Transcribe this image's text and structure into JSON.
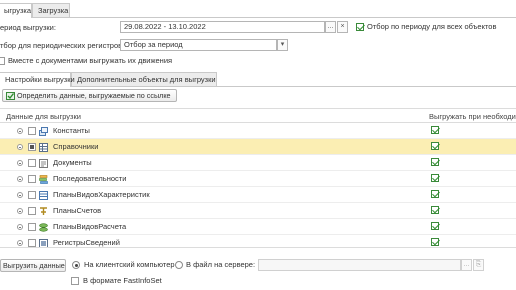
{
  "top_tabs": [
    {
      "label": "ыгрузка",
      "active": true
    },
    {
      "label": "Загрузка",
      "active": false
    }
  ],
  "period": {
    "label": "ериод выгрузки:",
    "value": "29.08.2022 - 13.10.2022",
    "select_button": "...",
    "clear_button": "×",
    "all_objects_label": "Отбор по периоду для всех объектов",
    "all_objects_checked": true
  },
  "periodic_registers": {
    "label": "тбор для периодических регистров:",
    "value": "Отбор за период",
    "dropdown_icon": "▾"
  },
  "docs_movements": {
    "label": "Вместе с документами выгружать их движения",
    "checked": false
  },
  "inner_tabs": [
    {
      "label": "Настройки выгрузки",
      "active": true
    },
    {
      "label": "Дополнительные объекты для выгрузки",
      "active": false
    }
  ],
  "define_button_label": "Определить данные, выгружаемые по ссылке",
  "table": {
    "col_data": "Данные для выгрузки",
    "col_export": "Выгружать при необходим",
    "rows": [
      {
        "label": "Константы",
        "icon": "constants-icon",
        "export": true,
        "selected": false
      },
      {
        "label": "Справочники",
        "icon": "catalogs-icon",
        "export": true,
        "selected": true
      },
      {
        "label": "Документы",
        "icon": "documents-icon",
        "export": true,
        "selected": false
      },
      {
        "label": "Последовательности",
        "icon": "sequences-icon",
        "export": true,
        "selected": false
      },
      {
        "label": "ПланыВидовХарактеристик",
        "icon": "charts-of-characteristic-types-icon",
        "export": true,
        "selected": false
      },
      {
        "label": "ПланыСчетов",
        "icon": "charts-of-accounts-icon",
        "export": true,
        "selected": false
      },
      {
        "label": "ПланыВидовРасчета",
        "icon": "charts-of-calculation-types-icon",
        "export": true,
        "selected": false
      },
      {
        "label": "РегистрыСведений",
        "icon": "information-registers-icon",
        "export": true,
        "selected": false
      }
    ]
  },
  "bottom": {
    "export_button": "Выгрузить данные",
    "radio_client": "На клиентский компьютер",
    "radio_server": "В файл на сервере:",
    "client_selected": true,
    "server_path": "",
    "fastinfoset_label": "В формате FastInfoSet",
    "fastinfoset_checked": false
  }
}
